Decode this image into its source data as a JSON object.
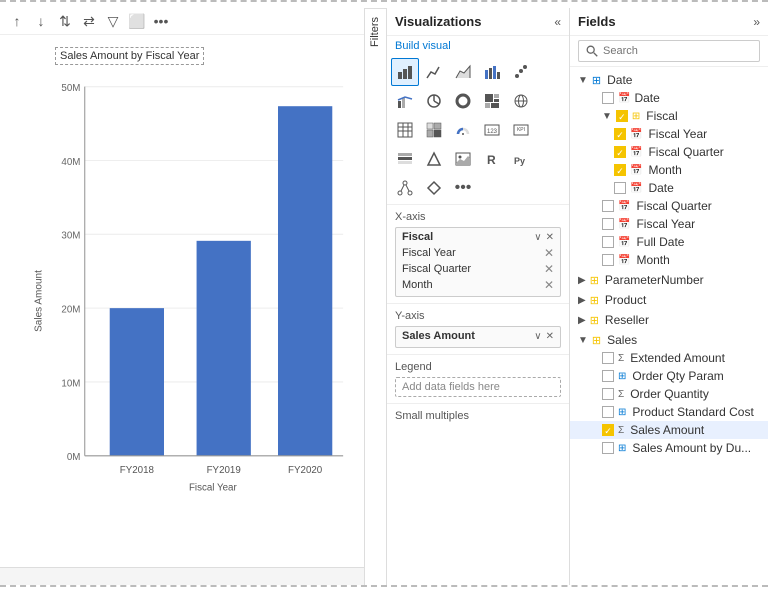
{
  "chart": {
    "title": "Sales Amount by Fiscal Year",
    "y_axis_label": "Sales Amount",
    "x_axis_label": "Fiscal Year",
    "bars": [
      {
        "label": "FY2018",
        "value": 22,
        "max": 55
      },
      {
        "label": "FY2019",
        "value": 32,
        "max": 55
      },
      {
        "label": "FY2020",
        "value": 52,
        "max": 55
      }
    ],
    "y_ticks": [
      "50M",
      "40M",
      "30M",
      "20M",
      "10M",
      "0M"
    ]
  },
  "toolbar": {
    "icons": [
      "↑",
      "↓",
      "⇅",
      "⇄",
      "▽",
      "⬜",
      "•••"
    ]
  },
  "visualizations": {
    "title": "Visualizations",
    "build_visual": "Build visual",
    "expand_icon": "»",
    "collapse_icon": "«"
  },
  "filters": {
    "label": "Filters"
  },
  "xaxis": {
    "label": "X-axis",
    "field_name": "Fiscal",
    "items": [
      "Fiscal Year",
      "Fiscal Quarter",
      "Month"
    ]
  },
  "yaxis": {
    "label": "Y-axis",
    "field_name": "Sales Amount"
  },
  "legend": {
    "label": "Legend",
    "placeholder": "Add data fields here"
  },
  "small_multiples": {
    "label": "Small multiples"
  },
  "fields": {
    "title": "Fields",
    "expand_icon": "»",
    "search_placeholder": "Search",
    "groups": [
      {
        "name": "Date",
        "icon": "🗓",
        "expanded": true,
        "items": [
          {
            "name": "Date",
            "checked": false,
            "type": "cal",
            "indent": 1
          },
          {
            "name": "Fiscal",
            "checked": true,
            "type": "folder",
            "indent": 1,
            "expanded": true,
            "children": [
              {
                "name": "Fiscal Year",
                "checked": true,
                "type": "cal",
                "indent": 2
              },
              {
                "name": "Fiscal Quarter",
                "checked": true,
                "type": "cal",
                "indent": 2
              },
              {
                "name": "Month",
                "checked": true,
                "type": "cal",
                "indent": 2
              },
              {
                "name": "Date",
                "checked": false,
                "type": "cal",
                "indent": 2
              }
            ]
          },
          {
            "name": "Fiscal Quarter",
            "checked": false,
            "type": "cal",
            "indent": 1
          },
          {
            "name": "Fiscal Year",
            "checked": false,
            "type": "cal",
            "indent": 1
          },
          {
            "name": "Full Date",
            "checked": false,
            "type": "cal",
            "indent": 1
          },
          {
            "name": "Month",
            "checked": false,
            "type": "cal",
            "indent": 1
          }
        ]
      },
      {
        "name": "ParameterNumber",
        "icon": "🗓",
        "expanded": false,
        "items": []
      },
      {
        "name": "Product",
        "icon": "🗓",
        "expanded": false,
        "items": []
      },
      {
        "name": "Reseller",
        "icon": "🗓",
        "expanded": false,
        "items": []
      },
      {
        "name": "Sales",
        "icon": "🗓",
        "expanded": true,
        "items": [
          {
            "name": "Extended Amount",
            "checked": false,
            "type": "sum",
            "indent": 1
          },
          {
            "name": "Order Qty Param",
            "checked": false,
            "type": "table",
            "indent": 1
          },
          {
            "name": "Order Quantity",
            "checked": false,
            "type": "sum",
            "indent": 1
          },
          {
            "name": "Product Standard Cost",
            "checked": false,
            "type": "table",
            "indent": 1
          },
          {
            "name": "Sales Amount",
            "checked": true,
            "type": "sum",
            "indent": 1
          },
          {
            "name": "Sales Amount by Du...",
            "checked": false,
            "type": "table",
            "indent": 1
          }
        ]
      }
    ]
  }
}
